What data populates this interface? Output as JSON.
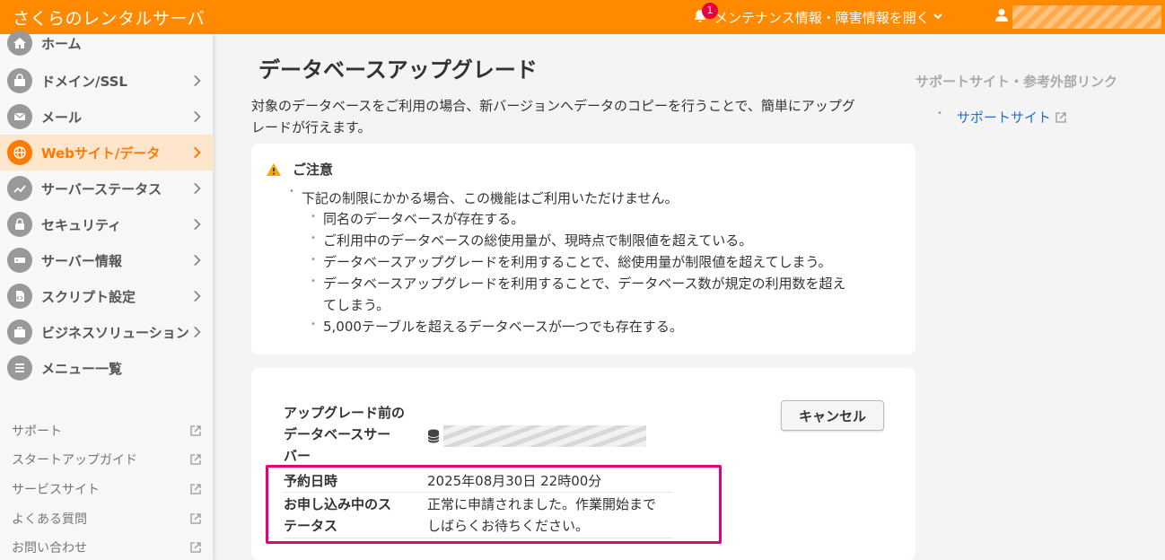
{
  "header": {
    "brand": "さくらのレンタルサーバ",
    "notification_count": "1",
    "notification_label": "メンテナンス情報・障害情報を開く"
  },
  "sidebar": {
    "items": [
      {
        "label": "ホーム",
        "icon": "home-icon"
      },
      {
        "label": "ドメイン/SSL",
        "icon": "domain-icon"
      },
      {
        "label": "メール",
        "icon": "mail-icon"
      },
      {
        "label": "Webサイト/データ",
        "icon": "globe-icon",
        "active": true
      },
      {
        "label": "サーバーステータス",
        "icon": "chart-icon"
      },
      {
        "label": "セキュリティ",
        "icon": "lock-icon"
      },
      {
        "label": "サーバー情報",
        "icon": "server-icon"
      },
      {
        "label": "スクリプト設定",
        "icon": "script-icon"
      },
      {
        "label": "ビジネスソリューション",
        "icon": "briefcase-icon"
      },
      {
        "label": "メニュー一覧",
        "icon": "list-icon"
      }
    ],
    "links": [
      "サポート",
      "スタートアップガイド",
      "サービスサイト",
      "よくある質問",
      "お問い合わせ"
    ]
  },
  "main": {
    "title": "データベースアップグレード",
    "intro_line1": "対象のデータベースをご利用の場合、新バージョンへデータのコピーを行うことで、簡単にアップグ",
    "intro_line2": "レードが行えます。",
    "notice": {
      "title": "ご注意",
      "lead": "下記の制限にかかる場合、この機能はご利用いただけません。",
      "items": [
        "同名のデータベースが存在する。",
        "ご利用中のデータベースの総使用量が、現時点で制限値を超えている。",
        "データベースアップグレードを利用することで、総使用量が制限値を超えてしまう。",
        "データベースアップグレードを利用することで、データベース数が規定の利用数を超え",
        "てしまう。",
        "5,000テーブルを超えるデータベースが一つでも存在する。"
      ]
    },
    "db": {
      "server_label_1": "アップグレード前の",
      "server_label_2": "データベースサー",
      "server_label_3": "バー",
      "reserved_label": "予約日時",
      "reserved_value": "2025年08月30日 22時00分",
      "status_label_1": "お申し込み中のス",
      "status_label_2": "テータス",
      "status_value_1": "正常に申請されました。作業開始まで",
      "status_value_2": "しばらくお待ちください。",
      "cancel_label": "キャンセル"
    }
  },
  "right": {
    "heading": "サポートサイト・参考外部リンク",
    "link": "サポートサイト"
  },
  "colors": {
    "brand": "#ff8a00",
    "active": "#ff7a00",
    "highlight": "#e6007e",
    "link": "#1e6fd9"
  }
}
